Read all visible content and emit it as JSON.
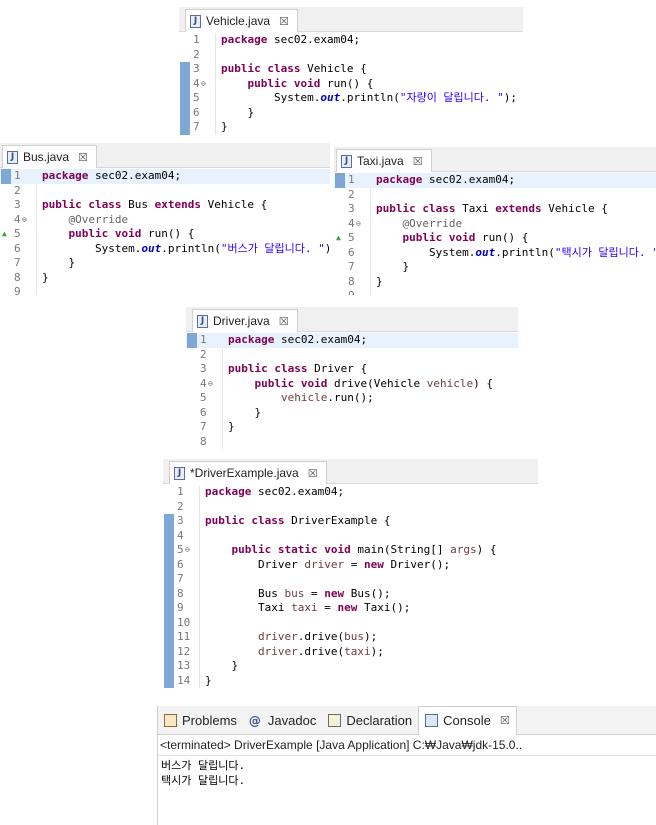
{
  "editors": [
    {
      "id": "vehicle",
      "tab": "Vehicle.java",
      "lines": [
        {
          "n": "1",
          "t": "package sec02.exam04;"
        },
        {
          "n": "2",
          "t": ""
        },
        {
          "n": "3",
          "t": "public class Vehicle {"
        },
        {
          "n": "4",
          "t": "    public void run() {"
        },
        {
          "n": "5",
          "t": "        System.out.println(\"자량이 달립니다. \");"
        },
        {
          "n": "6",
          "t": "    }"
        },
        {
          "n": "7",
          "t": "}"
        }
      ]
    },
    {
      "id": "bus",
      "tab": "Bus.java",
      "lines": [
        {
          "n": "1",
          "t": "package sec02.exam04;"
        },
        {
          "n": "2",
          "t": ""
        },
        {
          "n": "3",
          "t": "public class Bus extends Vehicle {"
        },
        {
          "n": "4",
          "t": "    @Override"
        },
        {
          "n": "5",
          "t": "    public void run() {"
        },
        {
          "n": "6",
          "t": "        System.out.println(\"버스가 달립니다. \");"
        },
        {
          "n": "7",
          "t": "    }"
        },
        {
          "n": "8",
          "t": "}"
        },
        {
          "n": "9",
          "t": ""
        }
      ]
    },
    {
      "id": "taxi",
      "tab": "Taxi.java",
      "lines": [
        {
          "n": "1",
          "t": "package sec02.exam04;"
        },
        {
          "n": "2",
          "t": ""
        },
        {
          "n": "3",
          "t": "public class Taxi extends Vehicle {"
        },
        {
          "n": "4",
          "t": "    @Override"
        },
        {
          "n": "5",
          "t": "    public void run() {"
        },
        {
          "n": "6",
          "t": "        System.out.println(\"택시가 달립니다. \");"
        },
        {
          "n": "7",
          "t": "    }"
        },
        {
          "n": "8",
          "t": "}"
        },
        {
          "n": "9",
          "t": ""
        }
      ]
    },
    {
      "id": "driver",
      "tab": "Driver.java",
      "lines": [
        {
          "n": "1",
          "t": "package sec02.exam04;"
        },
        {
          "n": "2",
          "t": ""
        },
        {
          "n": "3",
          "t": "public class Driver {"
        },
        {
          "n": "4",
          "t": "    public void drive(Vehicle vehicle) {"
        },
        {
          "n": "5",
          "t": "        vehicle.run();"
        },
        {
          "n": "6",
          "t": "    }"
        },
        {
          "n": "7",
          "t": "}"
        },
        {
          "n": "8",
          "t": ""
        }
      ]
    },
    {
      "id": "example",
      "tab": "*DriverExample.java",
      "lines": [
        {
          "n": "1",
          "t": "package sec02.exam04;"
        },
        {
          "n": "2",
          "t": ""
        },
        {
          "n": "3",
          "t": "public class DriverExample {"
        },
        {
          "n": "4",
          "t": ""
        },
        {
          "n": "5",
          "t": "    public static void main(String[] args) {"
        },
        {
          "n": "6",
          "t": "        Driver driver = new Driver();"
        },
        {
          "n": "7",
          "t": ""
        },
        {
          "n": "8",
          "t": "        Bus bus = new Bus();"
        },
        {
          "n": "9",
          "t": "        Taxi taxi = new Taxi();"
        },
        {
          "n": "10",
          "t": ""
        },
        {
          "n": "11",
          "t": "        driver.drive(bus);"
        },
        {
          "n": "12",
          "t": "        driver.drive(taxi);"
        },
        {
          "n": "13",
          "t": "    }"
        },
        {
          "n": "14",
          "t": "}"
        }
      ]
    }
  ],
  "console": {
    "tabs": [
      {
        "label": "Problems",
        "icon": "problems-icon"
      },
      {
        "label": "Javadoc",
        "icon": "javadoc-icon"
      },
      {
        "label": "Declaration",
        "icon": "declaration-icon"
      },
      {
        "label": "Console",
        "icon": "console-icon"
      }
    ],
    "close_glyph": "☒",
    "terminated": "<terminated> DriverExample [Java Application] C:₩Java₩jdk-15.0..",
    "output": [
      "버스가 달립니다.",
      "택시가 달립니다."
    ]
  },
  "colors": {
    "keyword": "#7f0055",
    "string": "#2a00ff",
    "annotation": "#646464",
    "ruler": "#7fa7d6"
  }
}
